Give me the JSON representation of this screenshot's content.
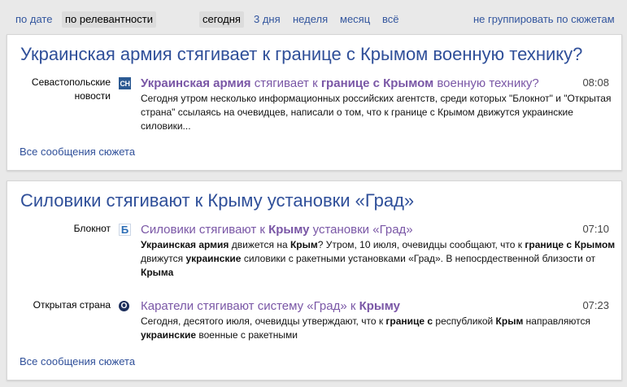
{
  "filters": {
    "by_date": "по дате",
    "by_relevance": "по релевантности",
    "today": "сегодня",
    "three_days": "3 дня",
    "week": "неделя",
    "month": "месяц",
    "all": "всё",
    "no_group": "не группировать по сюжетам"
  },
  "stories": [
    {
      "title": "Украинская армия стягивает к границе с Крымом военную технику?",
      "all_link": "Все сообщения сюжета",
      "items": [
        {
          "source": "Севастопольские новости",
          "icon": "sn-icon",
          "icon_text": "СН",
          "time": "08:08",
          "headline_parts": [
            {
              "t": "Украинская армия",
              "b": true
            },
            {
              "t": " стягивает к ",
              "b": false
            },
            {
              "t": "границе с Крымом",
              "b": true
            },
            {
              "t": " военную технику?",
              "b": false
            }
          ],
          "snippet_parts": [
            {
              "t": "Сегодня утром несколько информационных российских агентств, среди которых \"Блокнот\" и \"Открытая страна\" ссылаясь на очевидцев, написали о том, что к границе с Крымом движутся украинские силовики...",
              "b": false
            }
          ]
        }
      ]
    },
    {
      "title": "Силовики стягивают к Крыму установки «Град»",
      "all_link": "Все сообщения сюжета",
      "items": [
        {
          "source": "Блокнот",
          "icon": "bloknot-icon",
          "icon_text": "Б",
          "time": "07:10",
          "headline_parts": [
            {
              "t": "Силовики стягивают к ",
              "b": false
            },
            {
              "t": "Крыму",
              "b": true
            },
            {
              "t": " установки «Град»",
              "b": false
            }
          ],
          "snippet_parts": [
            {
              "t": "Украинская армия",
              "b": true
            },
            {
              "t": " движется на ",
              "b": false
            },
            {
              "t": "Крым",
              "b": true
            },
            {
              "t": "? Утром, 10 июля, очевидцы сообщают, что к ",
              "b": false
            },
            {
              "t": "границе с Крымом",
              "b": true
            },
            {
              "t": " движутся ",
              "b": false
            },
            {
              "t": "украинские",
              "b": true
            },
            {
              "t": " силовики с ракетными установками «Град». В непосрдественной близости от ",
              "b": false
            },
            {
              "t": "Крыма",
              "b": true
            }
          ]
        },
        {
          "source": "Открытая страна",
          "icon": "otkrytaya-strana-icon",
          "icon_text": "О",
          "time": "07:23",
          "headline_parts": [
            {
              "t": "Каратели стягивают систему «Град» к ",
              "b": false
            },
            {
              "t": "Крыму",
              "b": true
            }
          ],
          "snippet_parts": [
            {
              "t": "Сегодня, десятого июля, очевидцы утверждают, что к ",
              "b": false
            },
            {
              "t": "границе с",
              "b": true
            },
            {
              "t": " республикой ",
              "b": false
            },
            {
              "t": "Крым",
              "b": true
            },
            {
              "t": " направляются ",
              "b": false
            },
            {
              "t": "украинские",
              "b": true
            },
            {
              "t": " военные с ракетными",
              "b": false
            }
          ]
        }
      ]
    }
  ]
}
